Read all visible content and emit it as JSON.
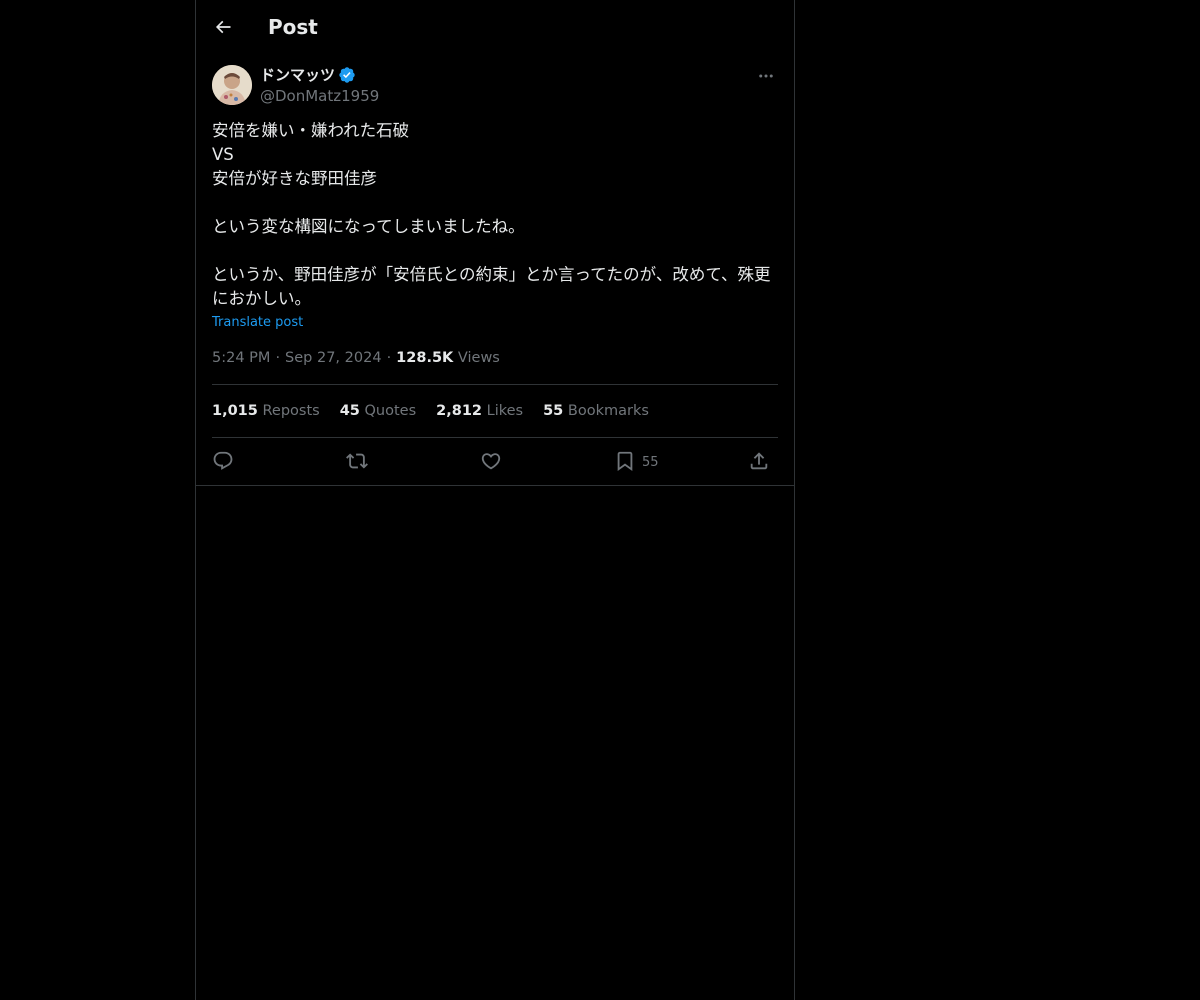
{
  "header": {
    "title": "Post",
    "back_icon": "arrow-left-icon"
  },
  "author": {
    "display_name": "ドンマッツ",
    "handle": "@DonMatz1959",
    "verified": true,
    "verified_color": "#1d9bf0"
  },
  "post": {
    "text": "安倍を嫌い・嫌われた石破\nVS\n安倍が好きな野田佳彦\n\nという変な構図になってしまいましたね。\n\nというか、野田佳彦が「安倍氏との約束」とか言ってたのが、改めて、殊更におかしい。",
    "translate_label": "Translate post",
    "time": "5:24 PM",
    "date": "Sep 27, 2024",
    "views_count": "128.5K",
    "views_label": "Views",
    "separator": "·"
  },
  "stats": [
    {
      "count": "1,015",
      "label": "Reposts"
    },
    {
      "count": "45",
      "label": "Quotes"
    },
    {
      "count": "2,812",
      "label": "Likes"
    },
    {
      "count": "55",
      "label": "Bookmarks"
    }
  ],
  "actions": {
    "reply_icon": "reply-icon",
    "repost_icon": "repost-icon",
    "like_icon": "heart-icon",
    "bookmark_icon": "bookmark-icon",
    "bookmark_count": "55",
    "share_icon": "share-icon"
  },
  "colors": {
    "background": "#000000",
    "text": "#e7e9ea",
    "muted": "#71767b",
    "link": "#1d9bf0",
    "border": "#2f3336"
  }
}
